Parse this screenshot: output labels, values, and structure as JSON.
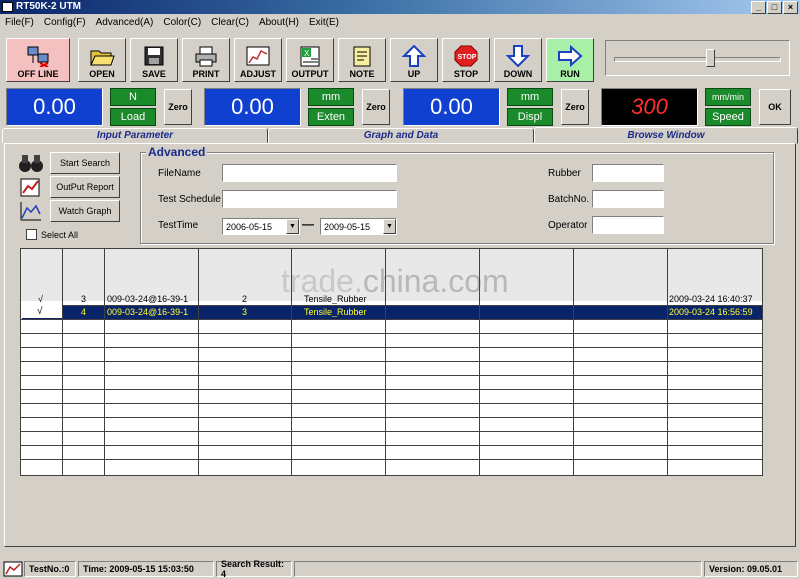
{
  "window": {
    "title": "RT50K-2 UTM",
    "controls": [
      "_",
      "□",
      "×"
    ]
  },
  "menu": [
    "File(F)",
    "Config(F)",
    "Advanced(A)",
    "Color(C)",
    "Clear(C)",
    "About(H)",
    "Exit(E)"
  ],
  "toolbar": {
    "offline": "OFF LINE",
    "open": "OPEN",
    "save": "SAVE",
    "print": "PRINT",
    "adjust": "ADJUST",
    "output": "OUTPUT",
    "note": "NOTE",
    "up": "UP",
    "stop": "STOP",
    "stop_sign": "STOP",
    "down": "DOWN",
    "run": "RUN"
  },
  "readouts": {
    "load": {
      "value": "0.00",
      "unit": "N",
      "name": "Load",
      "zero": "Zero"
    },
    "exten": {
      "value": "0.00",
      "unit": "mm",
      "name": "Exten",
      "zero": "Zero"
    },
    "displ": {
      "value": "0.00",
      "unit": "mm",
      "name": "Displ",
      "zero": "Zero"
    },
    "speed": {
      "value": "300",
      "unit": "mm/min",
      "name": "Speed",
      "ok": "OK"
    }
  },
  "tabs": [
    "Input Parameter",
    "Graph and Data",
    "Browse Window"
  ],
  "actions": {
    "start_search": "Start Search",
    "output_report": "OutPut Report",
    "watch_graph": "Watch Graph",
    "select_all": "Select All"
  },
  "advanced": {
    "title": "Advanced",
    "file_name_label": "FileName",
    "test_schedule_label": "Test Schedule",
    "test_time_label": "TestTime",
    "date_from": "2006-05-15",
    "date_sep": "—",
    "date_to": "2009-05-15",
    "rubber_label": "Rubber",
    "batch_label": "BatchNo.",
    "operator_label": "Operator"
  },
  "grid": {
    "watermark_a": "trade.",
    "watermark_b": "china.com",
    "rows": [
      {
        "check": "√",
        "no": "3",
        "id": "009-03-24@16-39-1",
        "seq": "2",
        "type": "Tensile_Rubber",
        "date": "2009-03-24 16:40:37"
      },
      {
        "check": "√",
        "no": "4",
        "id": "009-03-24@16-39-1",
        "seq": "3",
        "type": "Tensile_Rubber",
        "date": "2009-03-24 16:56:59"
      }
    ]
  },
  "status": {
    "test_no": "TestNo.:0",
    "time": "Time: 2009-05-15 15:03:50",
    "search_result": "Search Result: 4",
    "version": "Version: 09.05.01"
  },
  "colors": {
    "accent": "#1040d0",
    "unit_green": "#1a8a2a",
    "selection": "#0a246a"
  }
}
